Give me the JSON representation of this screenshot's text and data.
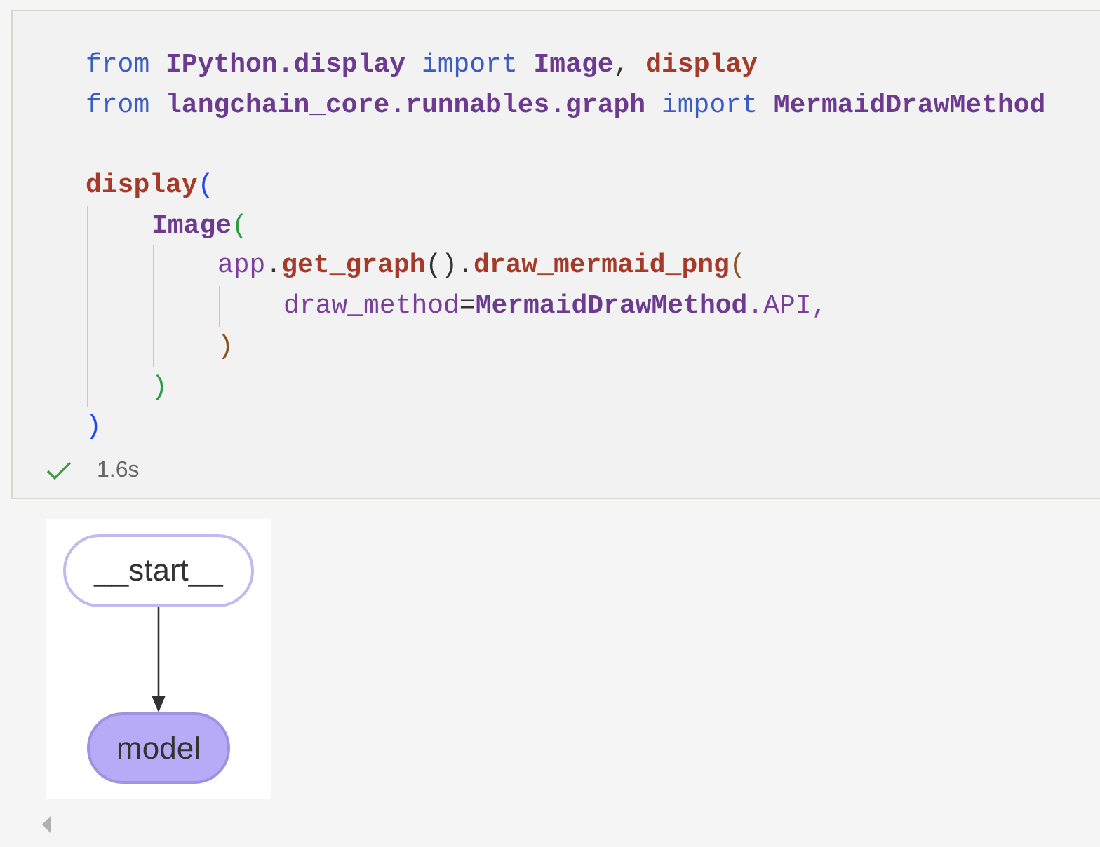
{
  "code_cell": {
    "lines": [
      {
        "kind": "code",
        "tokens": [
          {
            "text": "from ",
            "kind": "keyword"
          },
          {
            "text": "IPython.display ",
            "kind": "module"
          },
          {
            "text": "import ",
            "kind": "keyword"
          },
          {
            "text": "Image",
            "kind": "module"
          },
          {
            "text": ", ",
            "kind": "plain"
          },
          {
            "text": "display",
            "kind": "function"
          }
        ]
      },
      {
        "kind": "code",
        "tokens": [
          {
            "text": "from ",
            "kind": "keyword"
          },
          {
            "text": "langchain_core.runnables.graph ",
            "kind": "module"
          },
          {
            "text": "import ",
            "kind": "keyword"
          },
          {
            "text": "MermaidDrawMethod",
            "kind": "module"
          }
        ]
      },
      {
        "kind": "blank"
      },
      {
        "kind": "code",
        "tokens": [
          {
            "text": "display",
            "kind": "function"
          },
          {
            "text": "(",
            "kind": "bracket1"
          }
        ],
        "children": [
          {
            "kind": "code",
            "tokens": [
              {
                "text": "Image",
                "kind": "module"
              },
              {
                "text": "(",
                "kind": "bracket2"
              }
            ],
            "children": [
              {
                "kind": "code",
                "tokens": [
                  {
                    "text": "app",
                    "kind": "name"
                  },
                  {
                    "text": ".",
                    "kind": "plain"
                  },
                  {
                    "text": "get_graph",
                    "kind": "function"
                  },
                  {
                    "text": "().",
                    "kind": "plain"
                  },
                  {
                    "text": "draw_mermaid_png",
                    "kind": "function"
                  },
                  {
                    "text": "(",
                    "kind": "bracket3"
                  }
                ],
                "children": [
                  {
                    "kind": "code",
                    "tokens": [
                      {
                        "text": "draw_method",
                        "kind": "name"
                      },
                      {
                        "text": "=",
                        "kind": "plain"
                      },
                      {
                        "text": "MermaidDrawMethod",
                        "kind": "module"
                      },
                      {
                        "text": ".API,",
                        "kind": "name"
                      }
                    ]
                  }
                ]
              },
              {
                "kind": "code",
                "tokens": [
                  {
                    "text": ")",
                    "kind": "bracket3"
                  }
                ]
              }
            ]
          },
          {
            "kind": "code",
            "tokens": [
              {
                "text": ")",
                "kind": "bracket2"
              }
            ]
          }
        ]
      },
      {
        "kind": "code",
        "tokens": [
          {
            "text": ")",
            "kind": "bracket1"
          }
        ]
      }
    ],
    "status": {
      "succeeded": true,
      "duration": "1.6s"
    }
  },
  "output": {
    "nodes": [
      {
        "label": "__start__",
        "kind": "start"
      },
      {
        "label": "model",
        "kind": "node"
      }
    ]
  }
}
